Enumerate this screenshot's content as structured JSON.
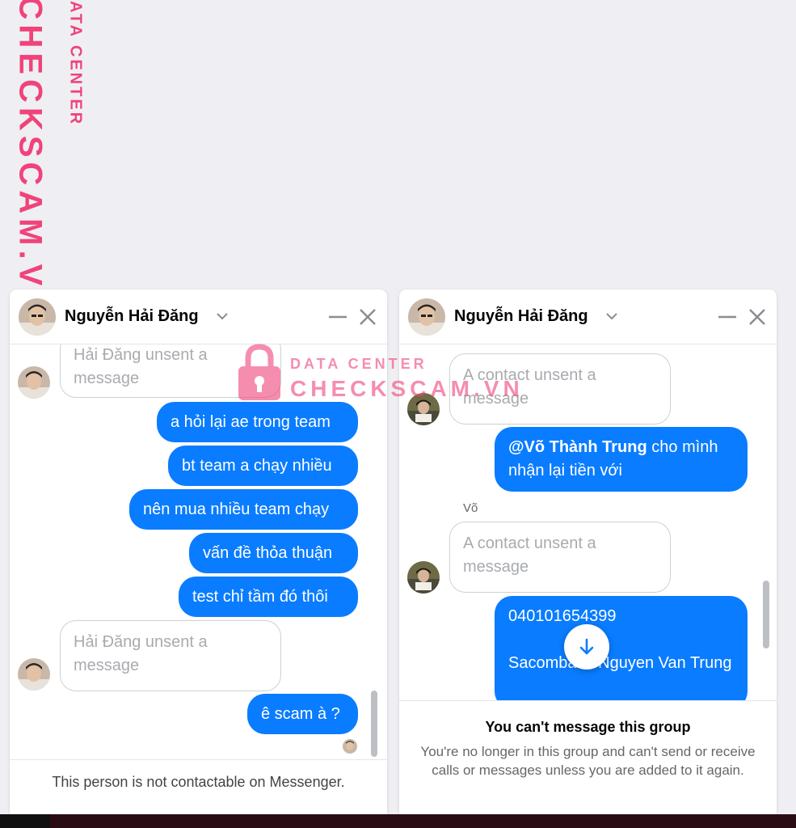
{
  "watermark": {
    "brand_big": "CHECKSCAM.VN",
    "brand_small": "DATA CENTER",
    "center_line1": "DATA CENTER",
    "center_line2": "CHECKSCAM.VN"
  },
  "chat_left": {
    "contact_name": "Nguyễn Hải Đăng",
    "messages": [
      {
        "type": "unsent",
        "text": "Hải Đăng unsent a message"
      },
      {
        "type": "outgoing",
        "text": "a hỏi lại ae trong team"
      },
      {
        "type": "outgoing",
        "text": "bt team a chạy nhiều"
      },
      {
        "type": "outgoing",
        "text": "nên mua nhiều team chạy"
      },
      {
        "type": "outgoing",
        "text": "vấn đề thỏa thuận"
      },
      {
        "type": "outgoing",
        "text": "test chỉ tầm đó thôi"
      },
      {
        "type": "unsent",
        "text": "Hải Đăng unsent a message"
      },
      {
        "type": "outgoing",
        "text": "ê scam à ?"
      }
    ],
    "footer_note": "This person is not contactable on Messenger."
  },
  "chat_right": {
    "contact_name": "Nguyễn Hải Đăng",
    "messages": [
      {
        "type": "unsent",
        "text": "A contact unsent a message"
      },
      {
        "type": "outgoing",
        "mention": "@Võ Thành Trung",
        "text": " cho mình nhận lại tiền với"
      },
      {
        "type": "sender_label",
        "text": "Võ"
      },
      {
        "type": "unsent",
        "text": "A contact unsent a message"
      },
      {
        "type": "outgoing",
        "line1": "040101654399",
        "line2": "Sacombank Nguyen Van Trung"
      }
    ],
    "footer_title": "You can't message this group",
    "footer_desc": "You're no longer in this group and can't send or receive calls or messages unless you are added to it again."
  },
  "colors": {
    "outgoing_bubble": "#0a7cff",
    "watermark": "#f0437a"
  },
  "icons": [
    "chevron-down-icon",
    "minimize-icon",
    "close-icon",
    "arrow-down-icon",
    "lock-icon"
  ]
}
